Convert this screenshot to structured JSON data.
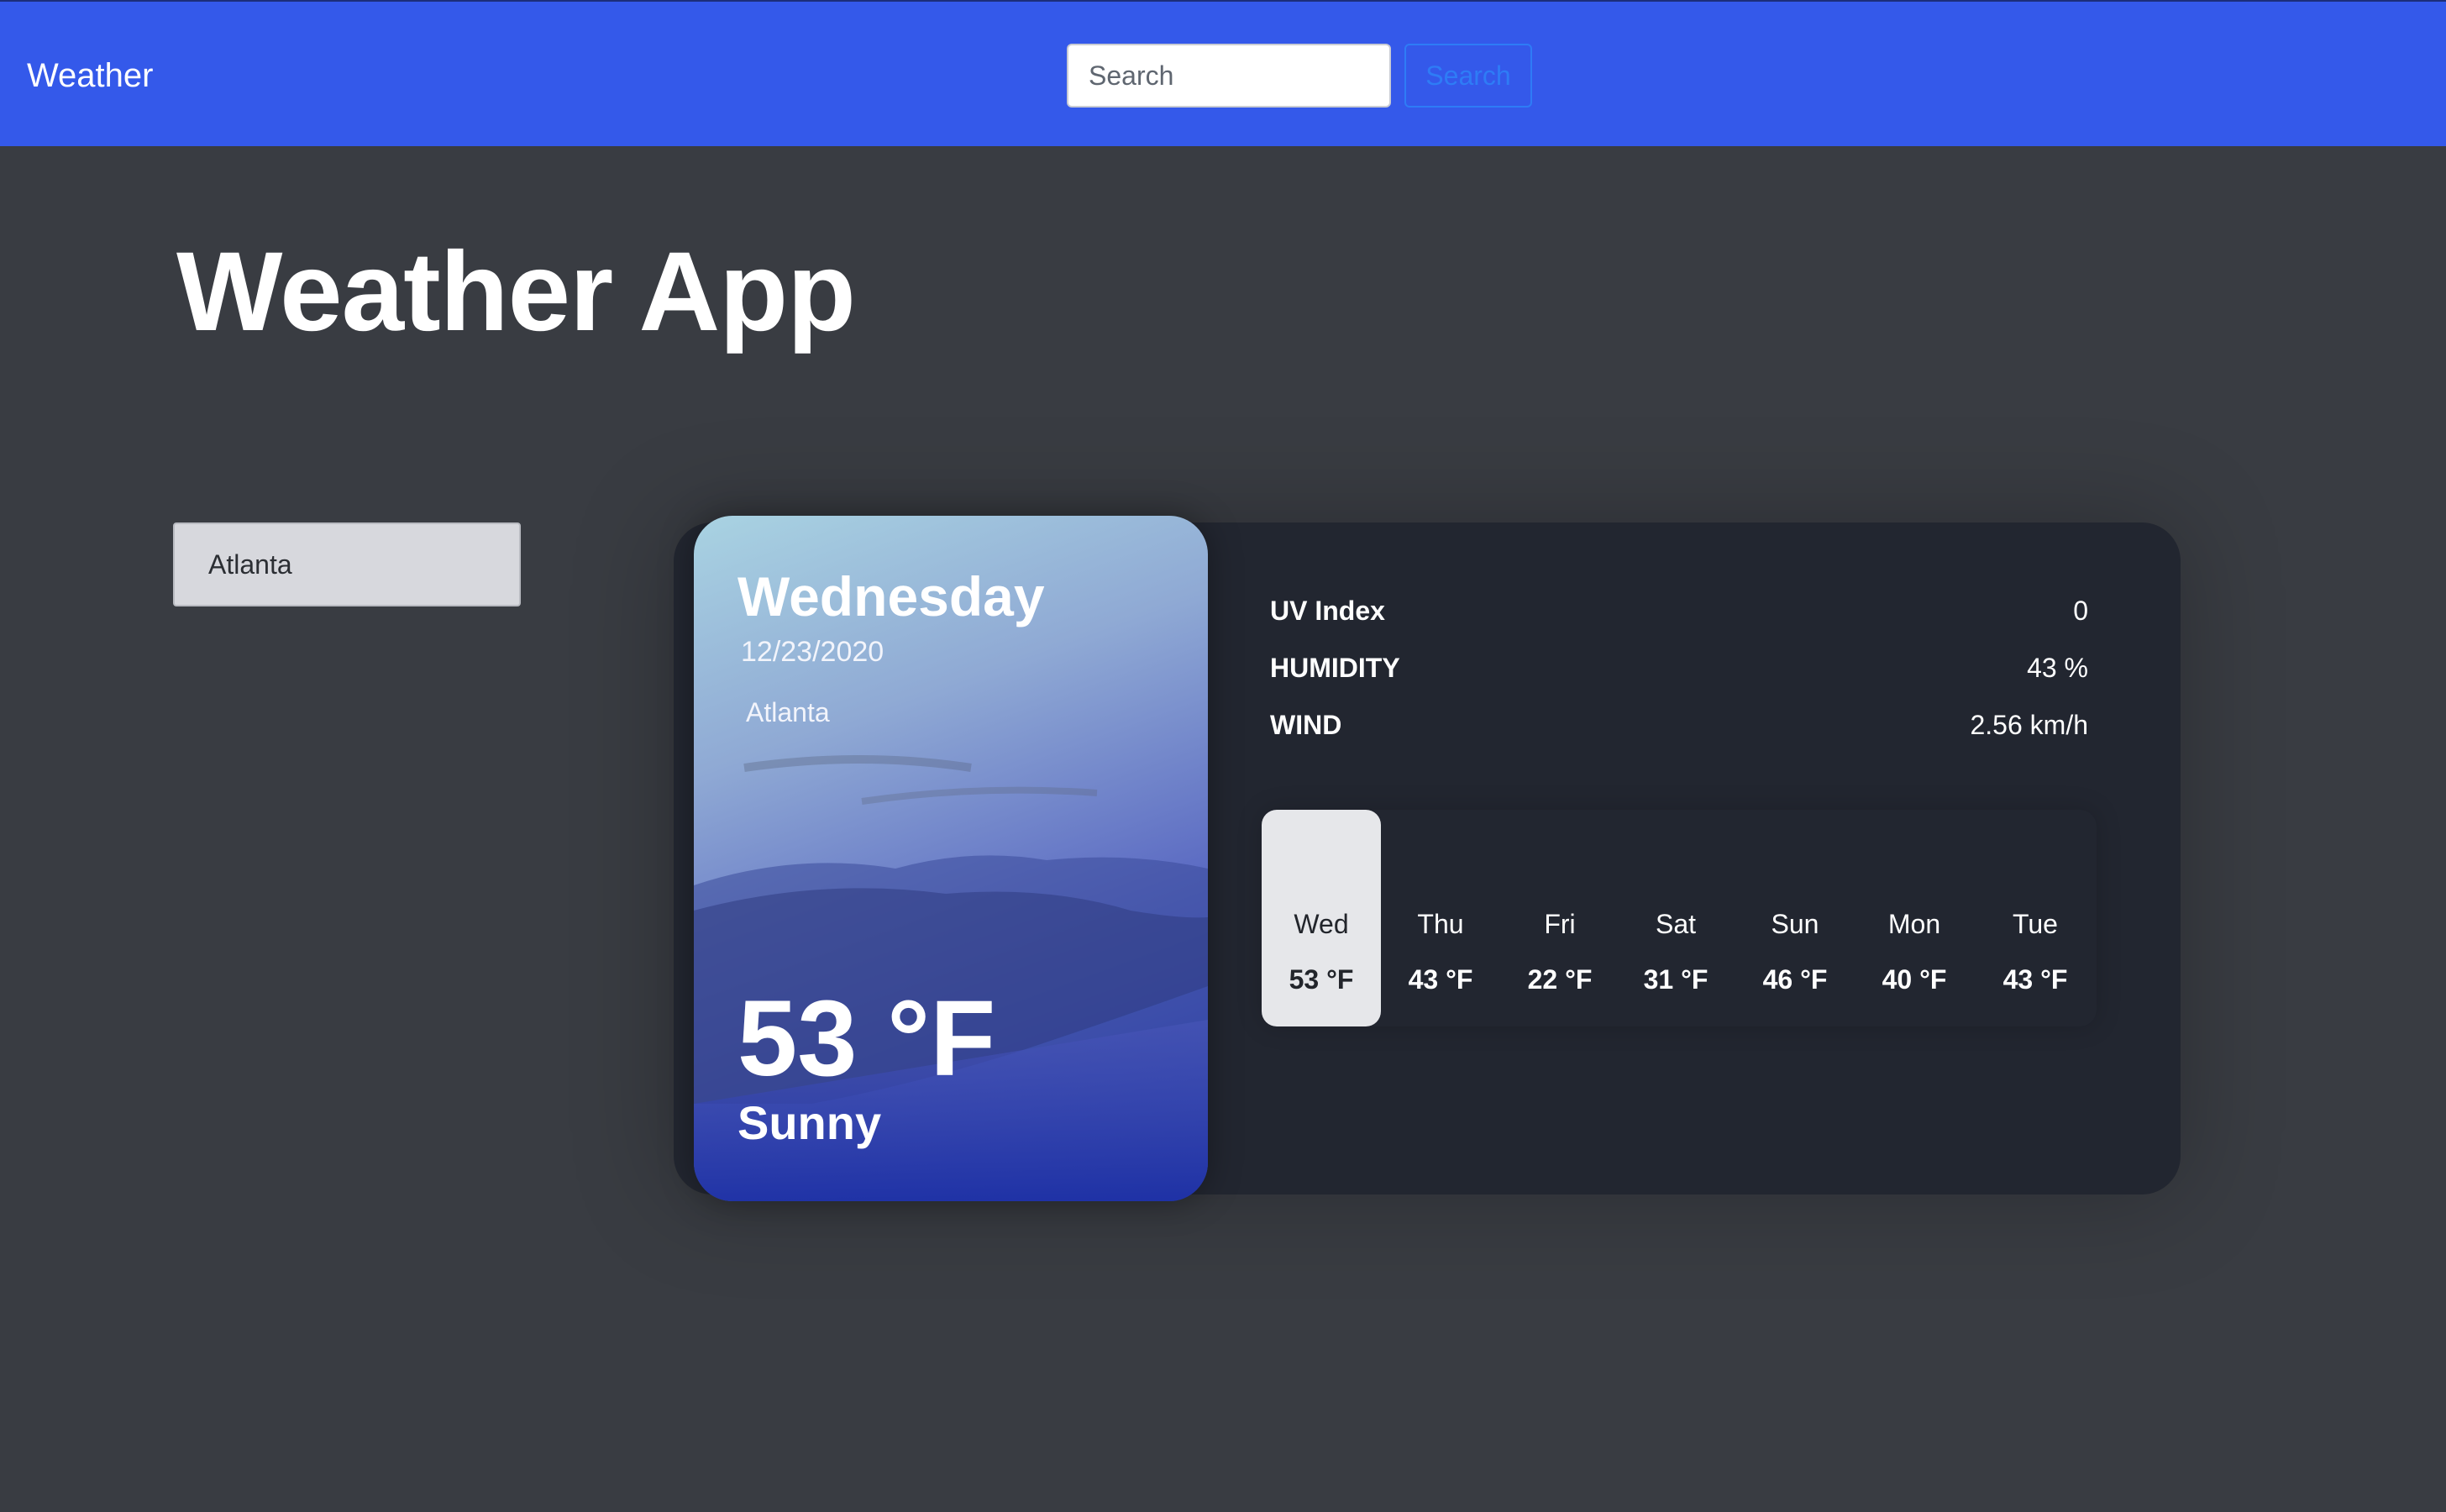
{
  "navbar": {
    "brand": "Weather",
    "search_placeholder": "Search",
    "search_button": "Search",
    "color": "#3459ea"
  },
  "page": {
    "title": "Weather App"
  },
  "saved_cities": [
    {
      "label": "Atlanta"
    }
  ],
  "today": {
    "day": "Wednesday",
    "date": "12/23/2020",
    "city": "Atlanta",
    "temperature": "53 °F",
    "condition": "Sunny"
  },
  "stats": [
    {
      "label": "UV Index",
      "value": "0"
    },
    {
      "label": "HUMIDITY",
      "value": "43 %"
    },
    {
      "label": "WIND",
      "value": "2.56 km/h"
    }
  ],
  "forecast": [
    {
      "day": "Wed",
      "temp": "53 °F",
      "selected": true
    },
    {
      "day": "Thu",
      "temp": "43 °F",
      "selected": false
    },
    {
      "day": "Fri",
      "temp": "22 °F",
      "selected": false
    },
    {
      "day": "Sat",
      "temp": "31 °F",
      "selected": false
    },
    {
      "day": "Sun",
      "temp": "46 °F",
      "selected": false
    },
    {
      "day": "Mon",
      "temp": "40 °F",
      "selected": false
    },
    {
      "day": "Tue",
      "temp": "43 °F",
      "selected": false
    }
  ]
}
